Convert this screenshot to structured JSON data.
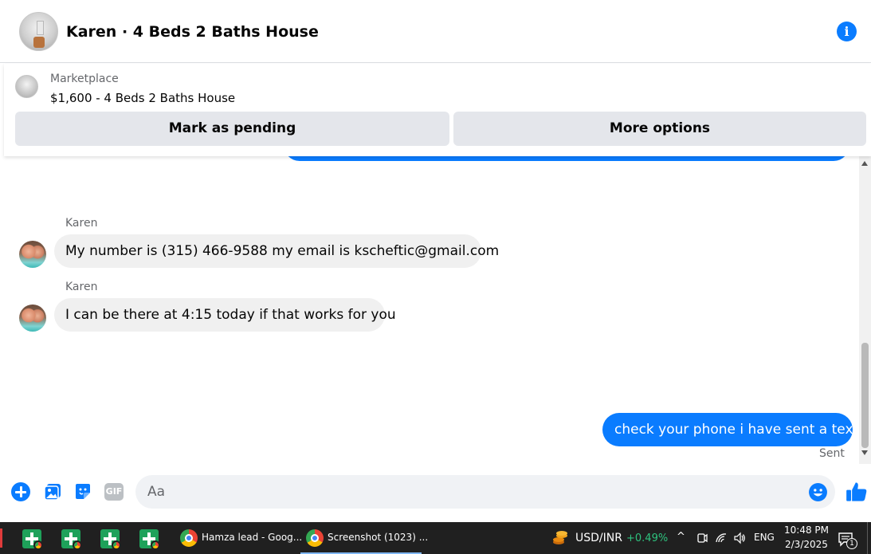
{
  "header": {
    "title": "Karen · 4 Beds 2 Baths House",
    "info_glyph": "i"
  },
  "listing": {
    "source_label": "Marketplace",
    "title": "$1,600 - 4 Beds 2 Baths House",
    "pending_label": "Mark as pending",
    "more_label": "More options"
  },
  "messages": [
    {
      "sender": "Karen",
      "text": "My number is (315) 466-9588 my email is kscheftic@gmail.com",
      "direction": "incoming"
    },
    {
      "sender": "Karen",
      "text": "I can be there at 4:15 today if that works for you",
      "direction": "incoming"
    },
    {
      "sender": "",
      "text": "check your phone i have sent a text",
      "direction": "outgoing"
    }
  ],
  "status": {
    "sent_label": "Sent"
  },
  "composer": {
    "placeholder": "Aa",
    "gif_label": "GIF"
  },
  "taskbar": {
    "tasks": [
      {
        "label": "Hamza lead - Goog..."
      },
      {
        "label": "Screenshot (1023) ..."
      }
    ],
    "ticker": {
      "name": "USD/INR",
      "change": "+0.49%"
    },
    "tray_chevron": "^",
    "language": "ENG",
    "time": "10:48 PM",
    "date": "2/3/2025",
    "notification_count": "1"
  },
  "colors": {
    "accent": "#0a7cff",
    "incoming_bubble": "#f0f0f0",
    "button_bg": "#e4e6eb",
    "taskbar_bg": "#202020",
    "ticker_up": "#2ec27e"
  },
  "icons": [
    "info-icon",
    "plus-icon",
    "gallery-icon",
    "sticker-icon",
    "gif-icon",
    "emoji-icon",
    "like-icon",
    "sheets-icon",
    "chrome-icon",
    "coin-icon",
    "wifi-icon",
    "volume-icon",
    "notification-icon"
  ]
}
